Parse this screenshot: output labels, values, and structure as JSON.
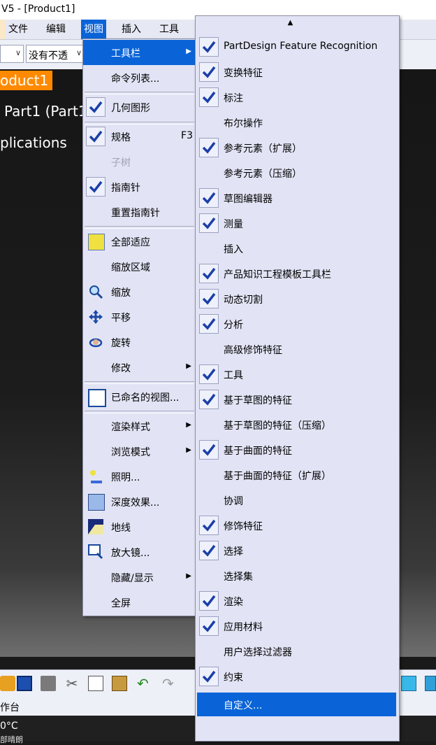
{
  "window": {
    "title": "V5 - [Product1]"
  },
  "menubar": {
    "items": [
      "文件",
      "编辑",
      "视图",
      "插入",
      "工具"
    ]
  },
  "toolbar": {
    "transparency_value": "没有不透"
  },
  "tree": {
    "root": "oduct1",
    "part": "Part1 (Part1",
    "apps": "plications"
  },
  "status": {
    "text": "作台"
  },
  "taskbar": {
    "temperature": "0°C",
    "weather": "部晴朗"
  },
  "view_menu": {
    "items": [
      {
        "label": "工具栏",
        "submenu": true,
        "highlighted": true
      },
      {
        "label": "命令列表..."
      },
      {
        "label": "几何图形",
        "checked": true
      },
      {
        "label": "规格",
        "checked": true,
        "shortcut": "F3"
      },
      {
        "label": "子树",
        "disabled": true
      },
      {
        "label": "指南针",
        "checked": true
      },
      {
        "label": "重置指南针"
      },
      {
        "label": "全部适应",
        "icon": "fit-all-icon"
      },
      {
        "label": "缩放区域"
      },
      {
        "label": "缩放",
        "icon": "zoom-icon"
      },
      {
        "label": "平移",
        "icon": "pan-icon"
      },
      {
        "label": "旋转",
        "icon": "rotate-icon"
      },
      {
        "label": "修改",
        "submenu": true
      },
      {
        "label": "已命名的视图...",
        "icon": "named-views-icon"
      },
      {
        "label": "渲染样式",
        "submenu": true
      },
      {
        "label": "浏览模式",
        "submenu": true
      },
      {
        "label": "照明...",
        "icon": "lighting-icon"
      },
      {
        "label": "深度效果...",
        "icon": "depth-effect-icon"
      },
      {
        "label": "地线",
        "icon": "ground-icon"
      },
      {
        "label": "放大镜...",
        "icon": "magnifier-icon"
      },
      {
        "label": "隐藏/显示",
        "submenu": true
      },
      {
        "label": "全屏"
      }
    ]
  },
  "toolbar_menu": {
    "scroll_up": "▲",
    "items": [
      {
        "label": "PartDesign Feature Recognition",
        "checked": true
      },
      {
        "label": "变换特征",
        "checked": true
      },
      {
        "label": "标注",
        "checked": true
      },
      {
        "label": "布尔操作",
        "checked": false
      },
      {
        "label": "参考元素（扩展）",
        "checked": true
      },
      {
        "label": "参考元素（压缩）",
        "checked": false
      },
      {
        "label": "草图编辑器",
        "checked": true
      },
      {
        "label": "测量",
        "checked": true
      },
      {
        "label": "插入",
        "checked": false
      },
      {
        "label": "产品知识工程模板工具栏",
        "checked": true
      },
      {
        "label": "动态切割",
        "checked": true
      },
      {
        "label": "分析",
        "checked": true
      },
      {
        "label": "高级修饰特征",
        "checked": false
      },
      {
        "label": "工具",
        "checked": true
      },
      {
        "label": "基于草图的特征",
        "checked": true
      },
      {
        "label": "基于草图的特征（压缩）",
        "checked": false
      },
      {
        "label": "基于曲面的特征",
        "checked": true
      },
      {
        "label": "基于曲面的特征（扩展）",
        "checked": false
      },
      {
        "label": "协调",
        "checked": false
      },
      {
        "label": "修饰特征",
        "checked": true
      },
      {
        "label": "选择",
        "checked": true
      },
      {
        "label": "选择集",
        "checked": false
      },
      {
        "label": "渲染",
        "checked": true
      },
      {
        "label": "应用材料",
        "checked": true
      },
      {
        "label": "用户选择过滤器",
        "checked": false
      },
      {
        "label": "约束",
        "checked": true
      }
    ],
    "customize": "自定义..."
  },
  "colors": {
    "menu_bg": "#e2e4f5",
    "highlight": "#0a64d8",
    "check": "#1b3fa8",
    "tree_root_bg": "#ff8a00"
  }
}
